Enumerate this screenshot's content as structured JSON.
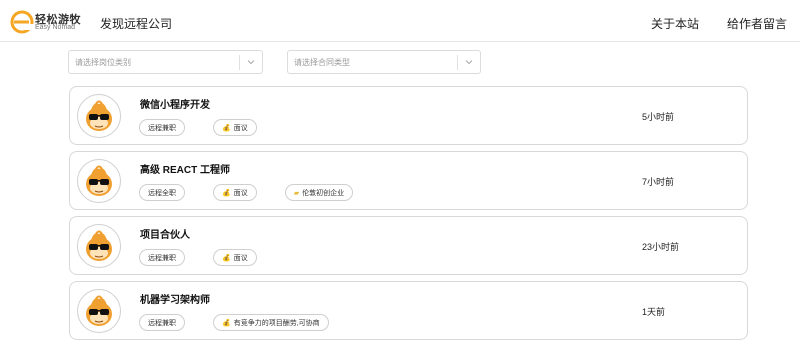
{
  "header": {
    "logo_cn": "轻松游牧",
    "logo_en": "Easy Nomad",
    "nav_discover": "发现远程公司",
    "nav_about": "关于本站",
    "nav_message": "给作者留言"
  },
  "filters": {
    "category_placeholder": "请选择岗位类别",
    "contract_placeholder": "请选择合同类型"
  },
  "jobs": [
    {
      "title": "微信小程序开发",
      "tags": [
        {
          "label": "远程兼职",
          "icon": ""
        },
        {
          "label": "面议",
          "icon": "money-bag-icon"
        }
      ],
      "time": "5小时前"
    },
    {
      "title": "高级 REACT 工程师",
      "tags": [
        {
          "label": "远程全职",
          "icon": ""
        },
        {
          "label": "面议",
          "icon": "money-bag-icon"
        },
        {
          "label": "伦敦初创企业",
          "icon": "folder-icon"
        }
      ],
      "time": "7小时前"
    },
    {
      "title": "项目合伙人",
      "tags": [
        {
          "label": "远程兼职",
          "icon": ""
        },
        {
          "label": "面议",
          "icon": "money-bag-icon"
        }
      ],
      "time": "23小时前"
    },
    {
      "title": "机器学习架构师",
      "tags": [
        {
          "label": "远程兼职",
          "icon": ""
        },
        {
          "label": "有竞争力的项目酬劳,可协商",
          "icon": "money-bag-icon"
        }
      ],
      "time": "1天前"
    }
  ],
  "colors": {
    "logo_orange": "#f5a623",
    "border": "#d8d8d8",
    "avatar_orange": "#f0a030"
  }
}
